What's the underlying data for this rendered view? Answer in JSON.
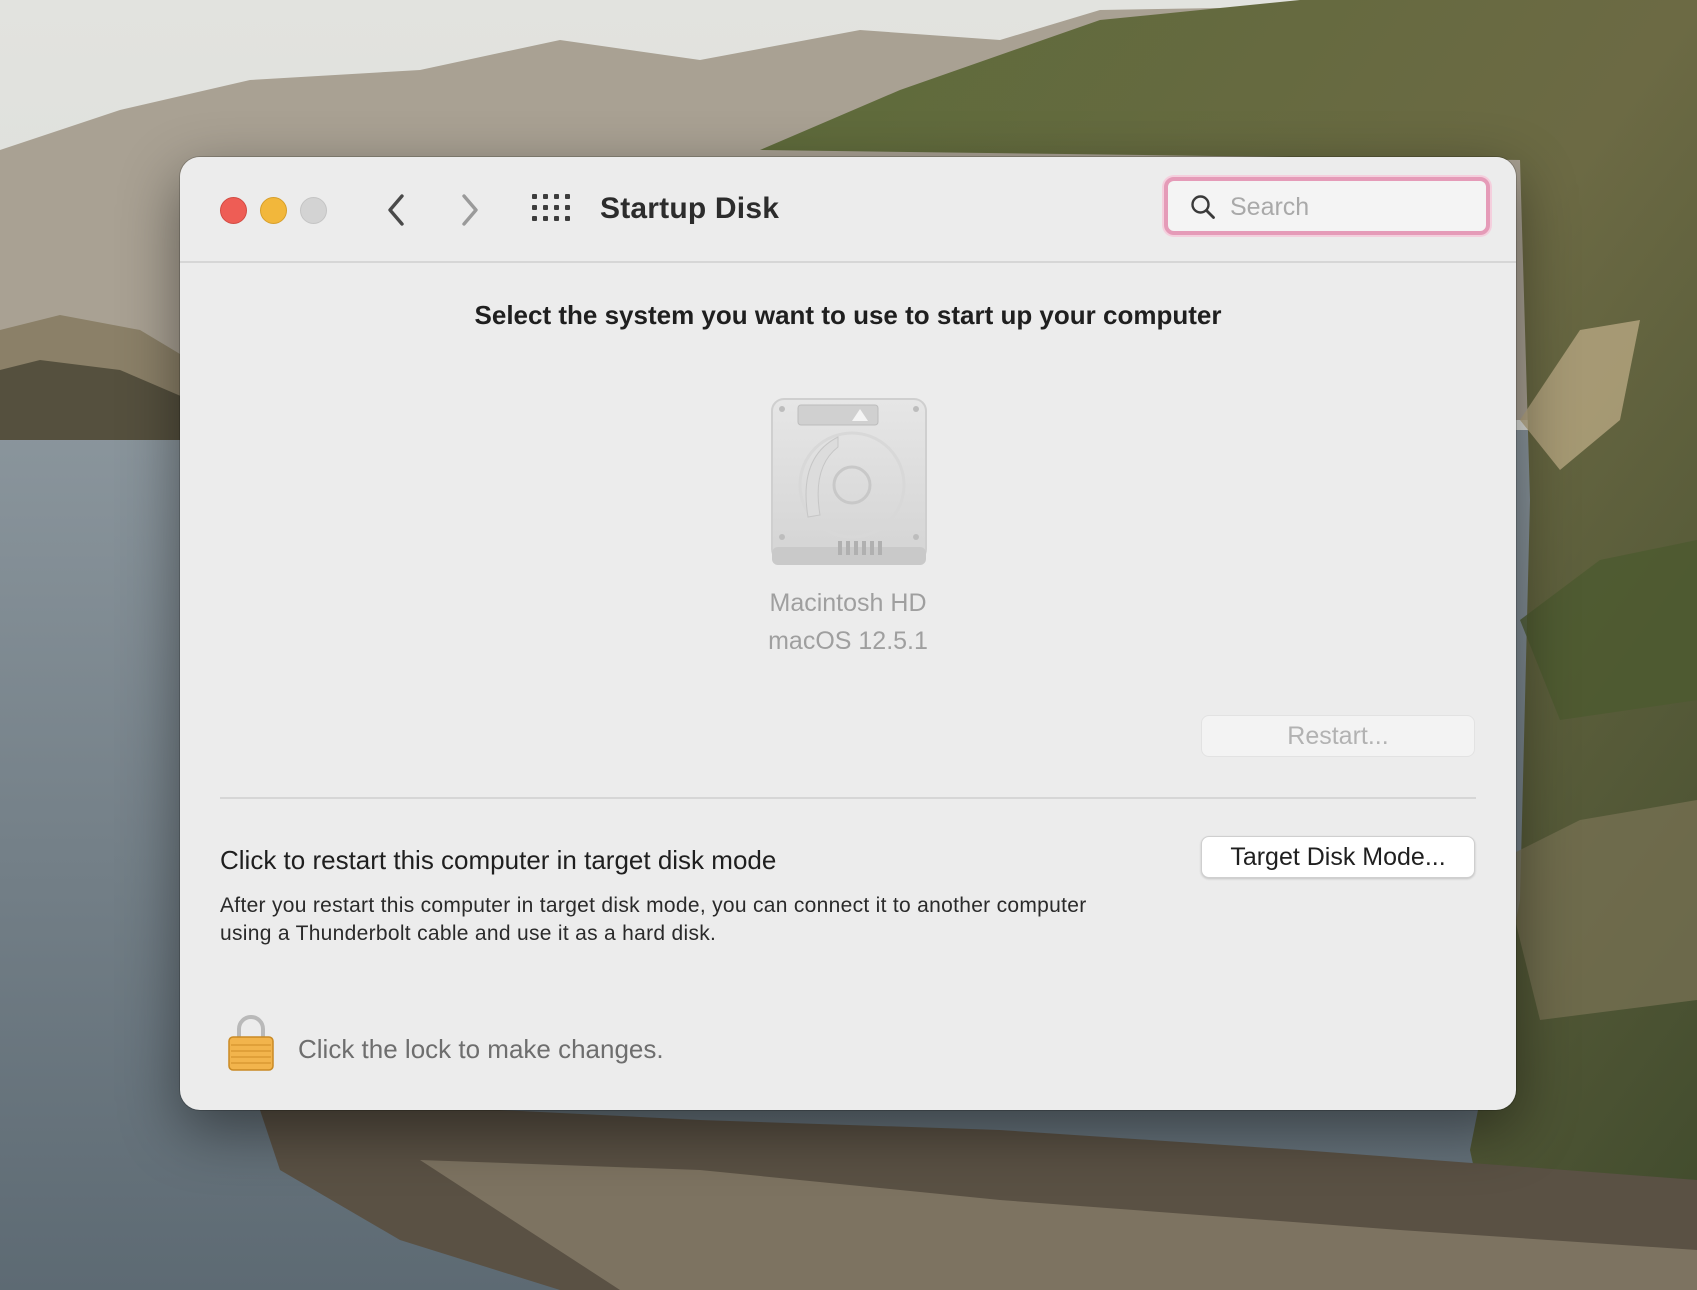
{
  "window": {
    "title": "Startup Disk",
    "search_placeholder": "Search"
  },
  "startup": {
    "heading": "Select the system you want to use to start up your computer",
    "disks": [
      {
        "name": "Macintosh HD",
        "os": "macOS 12.5.1"
      }
    ],
    "restart_label": "Restart..."
  },
  "target_disk": {
    "title": "Click to restart this computer in target disk mode",
    "description_line1": "After you restart this computer in target disk mode, you can connect it to another computer",
    "description_line2": "using a Thunderbolt cable and use it as a hard disk.",
    "button_label": "Target Disk Mode..."
  },
  "lock": {
    "text": "Click the lock to make changes."
  },
  "colors": {
    "close": "#ee5d55",
    "minimize": "#f2b73b",
    "zoom_disabled": "#d3d3d3",
    "search_focus_ring": "#e59bb8",
    "window_bg": "#ececec",
    "lock_gold": "#f2b44c"
  },
  "icons": [
    "back-chevron-icon",
    "forward-chevron-icon",
    "grid-icon",
    "search-icon",
    "hard-disk-icon",
    "padlock-icon"
  ]
}
